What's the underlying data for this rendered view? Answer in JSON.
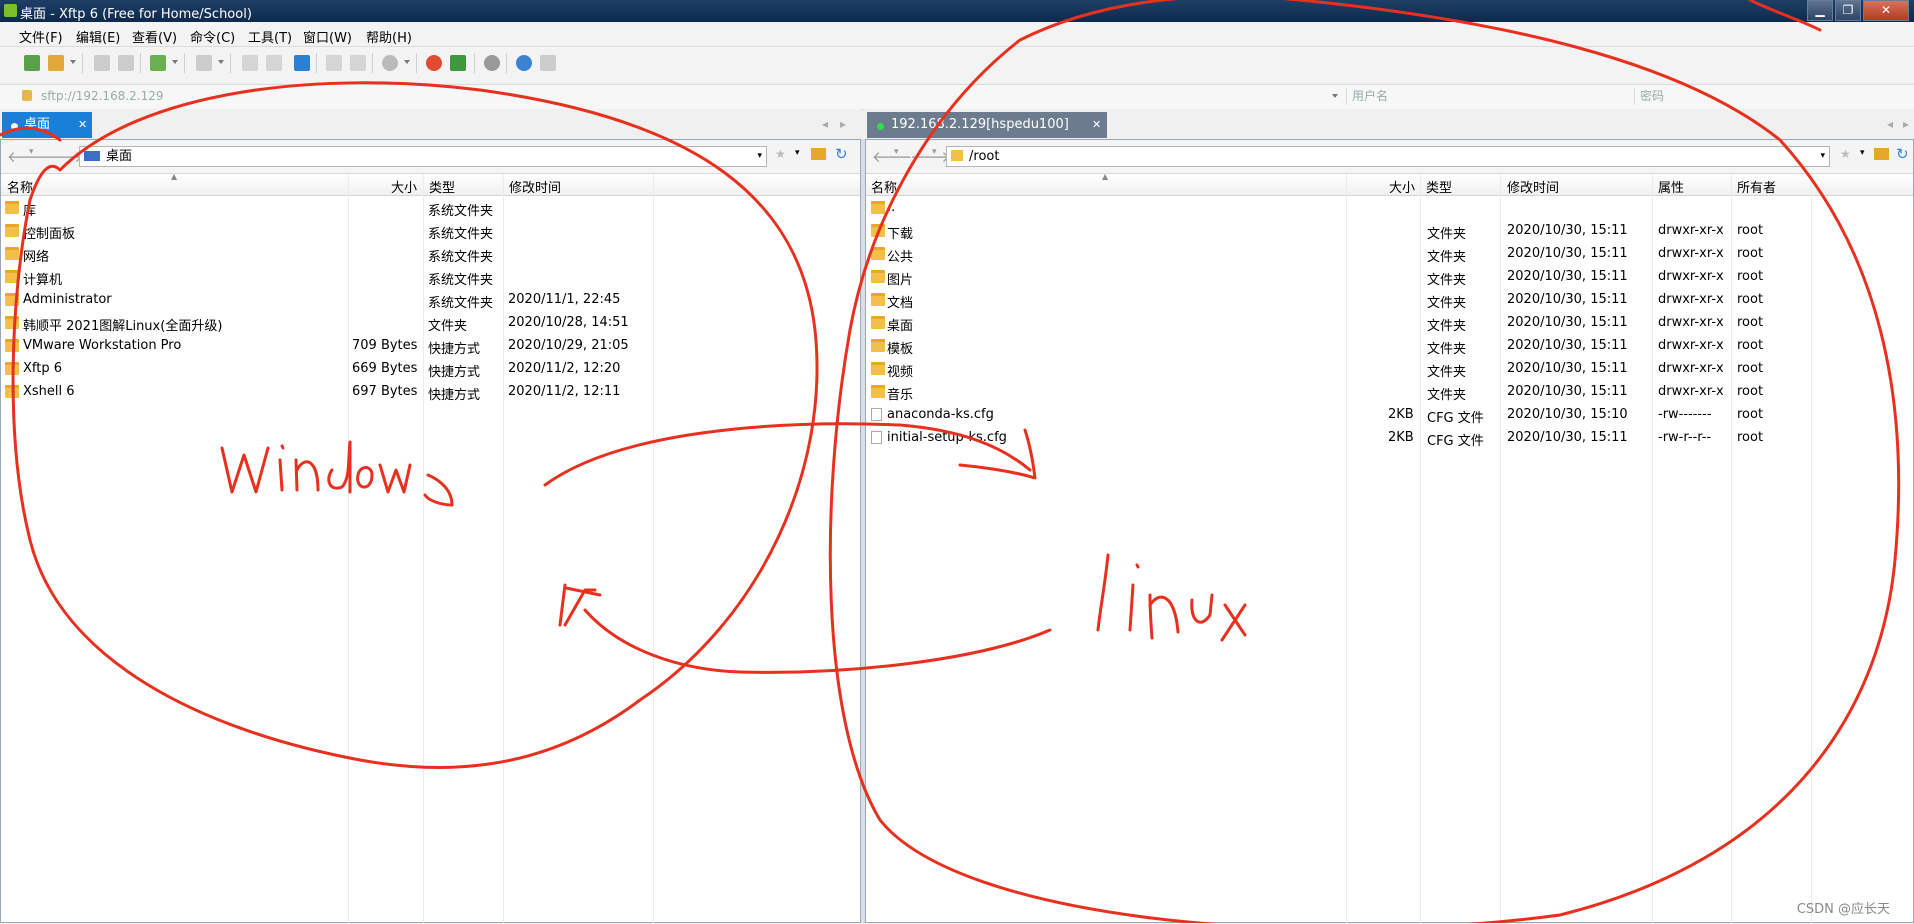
{
  "window": {
    "title": "桌面 - Xftp 6 (Free for Home/School)",
    "btn_min": "▁",
    "btn_max": "❐",
    "btn_close": "✕"
  },
  "menu": [
    "文件(F)",
    "编辑(E)",
    "查看(V)",
    "命令(C)",
    "工具(T)",
    "窗口(W)",
    "帮助(H)"
  ],
  "address": {
    "host": "sftp://192.168.2.129",
    "username_placeholder": "用户名",
    "password_placeholder": "密码"
  },
  "left": {
    "tab_label": "桌面",
    "path": "桌面",
    "columns": {
      "name": "名称",
      "size": "大小",
      "type": "类型",
      "modified": "修改时间"
    },
    "rows": [
      {
        "name": "库",
        "size": "",
        "type": "系统文件夹",
        "modified": "",
        "icon": "library-icon"
      },
      {
        "name": "控制面板",
        "size": "",
        "type": "系统文件夹",
        "modified": "",
        "icon": "control-panel-icon"
      },
      {
        "name": "网络",
        "size": "",
        "type": "系统文件夹",
        "modified": "",
        "icon": "network-icon"
      },
      {
        "name": "计算机",
        "size": "",
        "type": "系统文件夹",
        "modified": "",
        "icon": "computer-icon"
      },
      {
        "name": "Administrator",
        "size": "",
        "type": "系统文件夹",
        "modified": "2020/11/1, 22:45",
        "icon": "user-folder-icon"
      },
      {
        "name": "韩顺平 2021图解Linux(全面升级)",
        "size": "",
        "type": "文件夹",
        "modified": "2020/10/28, 14:51",
        "icon": "folder-icon"
      },
      {
        "name": "VMware Workstation Pro",
        "size": "709 Bytes",
        "type": "快捷方式",
        "modified": "2020/10/29, 21:05",
        "icon": "vmware-icon"
      },
      {
        "name": "Xftp 6",
        "size": "669 Bytes",
        "type": "快捷方式",
        "modified": "2020/11/2, 12:20",
        "icon": "xftp-icon"
      },
      {
        "name": "Xshell 6",
        "size": "697 Bytes",
        "type": "快捷方式",
        "modified": "2020/11/2, 12:11",
        "icon": "xshell-icon"
      }
    ]
  },
  "right": {
    "tab_label": "192.168.2.129[hspedu100]",
    "path": "/root",
    "columns": {
      "name": "名称",
      "size": "大小",
      "type": "类型",
      "modified": "修改时间",
      "perms": "属性",
      "owner": "所有者"
    },
    "rows": [
      {
        "name": "..",
        "size": "",
        "type": "",
        "modified": "",
        "perms": "",
        "owner": "",
        "icon": "folder-icon"
      },
      {
        "name": "下载",
        "size": "",
        "type": "文件夹",
        "modified": "2020/10/30, 15:11",
        "perms": "drwxr-xr-x",
        "owner": "root",
        "icon": "folder-icon"
      },
      {
        "name": "公共",
        "size": "",
        "type": "文件夹",
        "modified": "2020/10/30, 15:11",
        "perms": "drwxr-xr-x",
        "owner": "root",
        "icon": "folder-icon"
      },
      {
        "name": "图片",
        "size": "",
        "type": "文件夹",
        "modified": "2020/10/30, 15:11",
        "perms": "drwxr-xr-x",
        "owner": "root",
        "icon": "folder-icon"
      },
      {
        "name": "文档",
        "size": "",
        "type": "文件夹",
        "modified": "2020/10/30, 15:11",
        "perms": "drwxr-xr-x",
        "owner": "root",
        "icon": "folder-icon"
      },
      {
        "name": "桌面",
        "size": "",
        "type": "文件夹",
        "modified": "2020/10/30, 15:11",
        "perms": "drwxr-xr-x",
        "owner": "root",
        "icon": "folder-icon"
      },
      {
        "name": "模板",
        "size": "",
        "type": "文件夹",
        "modified": "2020/10/30, 15:11",
        "perms": "drwxr-xr-x",
        "owner": "root",
        "icon": "folder-icon"
      },
      {
        "name": "视频",
        "size": "",
        "type": "文件夹",
        "modified": "2020/10/30, 15:11",
        "perms": "drwxr-xr-x",
        "owner": "root",
        "icon": "folder-icon"
      },
      {
        "name": "音乐",
        "size": "",
        "type": "文件夹",
        "modified": "2020/10/30, 15:11",
        "perms": "drwxr-xr-x",
        "owner": "root",
        "icon": "folder-icon"
      },
      {
        "name": "anaconda-ks.cfg",
        "size": "2KB",
        "type": "CFG 文件",
        "modified": "2020/10/30, 15:10",
        "perms": "-rw-------",
        "owner": "root",
        "icon": "file-icon"
      },
      {
        "name": "initial-setup-ks.cfg",
        "size": "2KB",
        "type": "CFG 文件",
        "modified": "2020/10/30, 15:11",
        "perms": "-rw-r--r--",
        "owner": "root",
        "icon": "file-icon"
      }
    ]
  },
  "annotations": {
    "windows": "windows",
    "linux": "linux"
  },
  "watermark": "CSDN @应长天",
  "colors": {
    "annotation": "#e8301f",
    "active_tab": "#1a7fd6",
    "inactive_tab": "#6c7c8e"
  }
}
